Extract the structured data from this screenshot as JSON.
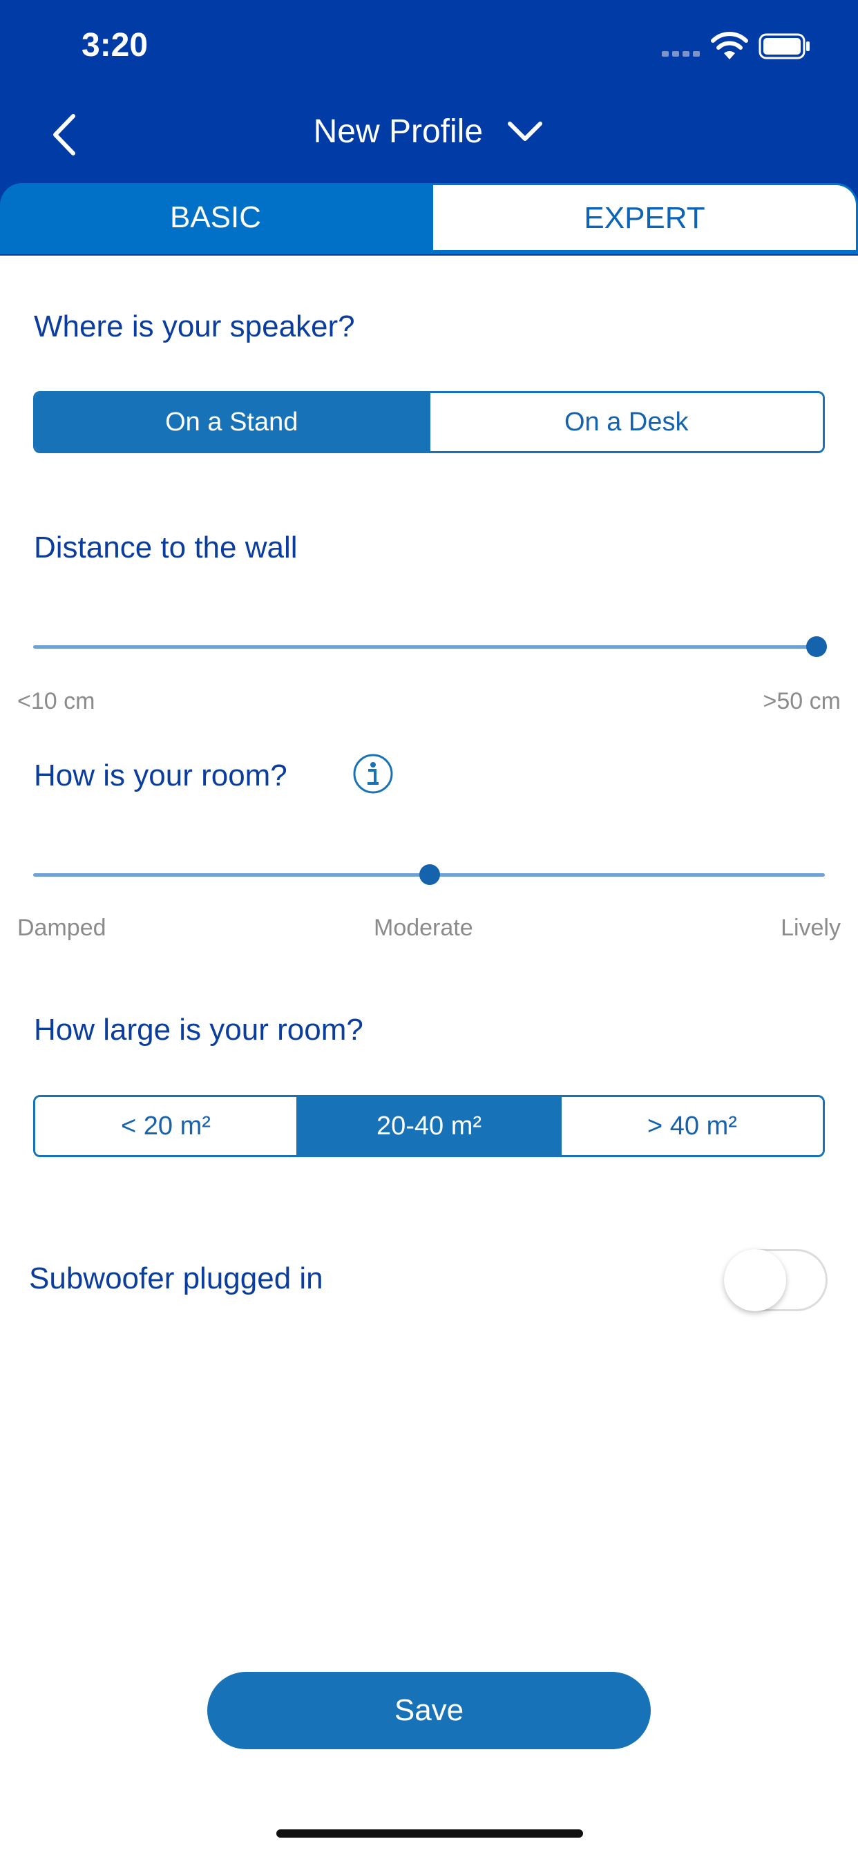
{
  "status_bar": {
    "time": "3:20"
  },
  "header": {
    "title": "New Profile"
  },
  "tabs": [
    {
      "label": "BASIC",
      "active": true
    },
    {
      "label": "EXPERT",
      "active": false
    }
  ],
  "speaker_position": {
    "question": "Where is your speaker?",
    "options": [
      "On a Stand",
      "On a Desk"
    ],
    "selected": "On a Stand"
  },
  "wall_distance": {
    "question": "Distance to the wall",
    "min_label": "<10 cm",
    "max_label": ">50 cm",
    "value_fraction": 1.0
  },
  "room_acoustics": {
    "question": "How is your room?",
    "labels": [
      "Damped",
      "Moderate",
      "Lively"
    ],
    "value_fraction": 0.5
  },
  "room_size": {
    "question": "How large is your room?",
    "options": [
      "< 20 m²",
      "20-40 m²",
      "> 40 m²"
    ],
    "selected": "20-40 m²"
  },
  "subwoofer": {
    "label": "Subwoofer plugged in",
    "enabled": false
  },
  "save_label": "Save",
  "colors": {
    "header_bg": "#013ca6",
    "accent": "#1872b8",
    "label_text": "#0a3d9e",
    "muted_text": "#8b8b8b"
  }
}
